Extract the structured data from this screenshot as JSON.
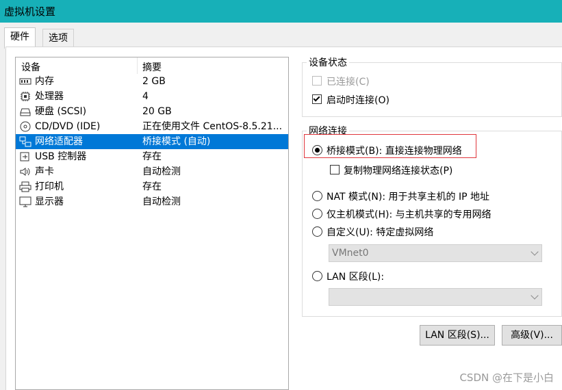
{
  "window": {
    "title": "虚拟机设置"
  },
  "tabs": [
    {
      "label": "硬件"
    },
    {
      "label": "选项"
    }
  ],
  "device_list": {
    "headers": {
      "device": "设备",
      "summary": "摘要"
    },
    "rows": [
      {
        "name": "内存",
        "summary": "2 GB",
        "icon": "memory-icon"
      },
      {
        "name": "处理器",
        "summary": "4",
        "icon": "cpu-icon"
      },
      {
        "name": "硬盘 (SCSI)",
        "summary": "20 GB",
        "icon": "harddisk-icon"
      },
      {
        "name": "CD/DVD (IDE)",
        "summary": "正在使用文件 CentOS-8.5.21...",
        "icon": "cd-icon"
      },
      {
        "name": "网络适配器",
        "summary": "桥接模式 (自动)",
        "icon": "network-icon",
        "selected": true
      },
      {
        "name": "USB 控制器",
        "summary": "存在",
        "icon": "usb-icon"
      },
      {
        "name": "声卡",
        "summary": "自动检测",
        "icon": "speaker-icon"
      },
      {
        "name": "打印机",
        "summary": "存在",
        "icon": "printer-icon"
      },
      {
        "name": "显示器",
        "summary": "自动检测",
        "icon": "monitor-icon"
      }
    ]
  },
  "device_status": {
    "legend": "设备状态",
    "connected": {
      "label": "已连接(C)",
      "checked": false,
      "disabled": true
    },
    "connect_on_start": {
      "label": "启动时连接(O)",
      "checked": true
    }
  },
  "network": {
    "legend": "网络连接",
    "bridged": {
      "label": "桥接模式(B): 直接连接物理网络",
      "selected": true
    },
    "replicate": {
      "label": "复制物理网络连接状态(P)",
      "checked": false
    },
    "nat": {
      "label": "NAT 模式(N): 用于共享主机的 IP 地址"
    },
    "host_only": {
      "label": "仅主机模式(H): 与主机共享的专用网络"
    },
    "custom": {
      "label": "自定义(U): 特定虚拟网络"
    },
    "custom_select": {
      "value": "VMnet0"
    },
    "lan": {
      "label": "LAN 区段(L):"
    },
    "lan_select": {
      "value": ""
    }
  },
  "buttons": {
    "lan_segments": "LAN 区段(S)...",
    "advanced": "高级(V)..."
  },
  "watermark": "CSDN @在下是小白",
  "colors": {
    "titlebar": "#17b0b8",
    "selection": "#0078d7",
    "highlight_box": "#e0353b"
  }
}
